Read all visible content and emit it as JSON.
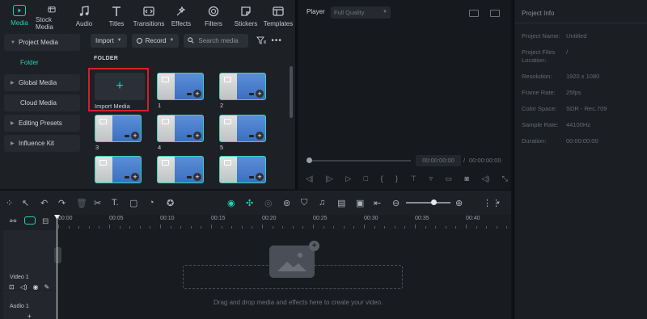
{
  "top_tabs": [
    {
      "label": "Media",
      "icon": "media-icon",
      "active": true
    },
    {
      "label": "Stock Media",
      "icon": "stock-media-icon"
    },
    {
      "label": "Audio",
      "icon": "music-note-icon"
    },
    {
      "label": "Titles",
      "icon": "text-t-icon"
    },
    {
      "label": "Transitions",
      "icon": "transitions-icon"
    },
    {
      "label": "Effects",
      "icon": "effects-sparkle-icon"
    },
    {
      "label": "Filters",
      "icon": "filters-icon"
    },
    {
      "label": "Stickers",
      "icon": "stickers-icon"
    },
    {
      "label": "Templates",
      "icon": "templates-icon"
    }
  ],
  "sidebar": {
    "items": [
      {
        "label": "Project Media",
        "caret": "▼"
      },
      {
        "label": "Folder"
      },
      {
        "label": "Global Media",
        "caret": "▶"
      },
      {
        "label": "Cloud Media"
      },
      {
        "label": "Editing Presets",
        "caret": "▶"
      },
      {
        "label": "Influence Kit",
        "caret": "▶"
      }
    ]
  },
  "media_toolbar": {
    "import_label": "Import",
    "record_label": "Record",
    "search_placeholder": "Search media"
  },
  "folder_label": "FOLDER",
  "import_tile": {
    "label": "Import Media",
    "plus": "+"
  },
  "clips": [
    {
      "label": "1"
    },
    {
      "label": "2"
    },
    {
      "label": "3"
    },
    {
      "label": "4"
    },
    {
      "label": "5"
    },
    {
      "label": ""
    },
    {
      "label": ""
    },
    {
      "label": ""
    }
  ],
  "player": {
    "title": "Player",
    "quality": "Full Quality",
    "timecode_current": "00:00:00:00",
    "timecode_sep": "/",
    "timecode_total": "00:00:00:00"
  },
  "project_info": {
    "title": "Project Info",
    "rows": [
      {
        "key": "Project Name:",
        "value": "Untitled"
      },
      {
        "key": "Project Files Location:",
        "value": "/"
      },
      {
        "key": "Resolution:",
        "value": "1920 x 1080"
      },
      {
        "key": "Frame Rate:",
        "value": "25fps"
      },
      {
        "key": "Color Space:",
        "value": "SDR - Rec.709"
      },
      {
        "key": "Sample Rate:",
        "value": "44100Hz"
      },
      {
        "key": "Duration:",
        "value": "00:00:00:00"
      }
    ]
  },
  "timeline": {
    "ruler": [
      "00:00",
      "00:05",
      "00:10",
      "00:15",
      "00:20",
      "00:25",
      "00:30",
      "00:35",
      "00:40"
    ],
    "video_track_label": "Video 1",
    "audio_track_label": "Audio 1",
    "drop_text": "Drag and drop media and effects here to create your video."
  },
  "colors": {
    "accent": "#23d0b4",
    "highlight_border": "#d51f2a",
    "panel_bg": "#1d2025"
  }
}
